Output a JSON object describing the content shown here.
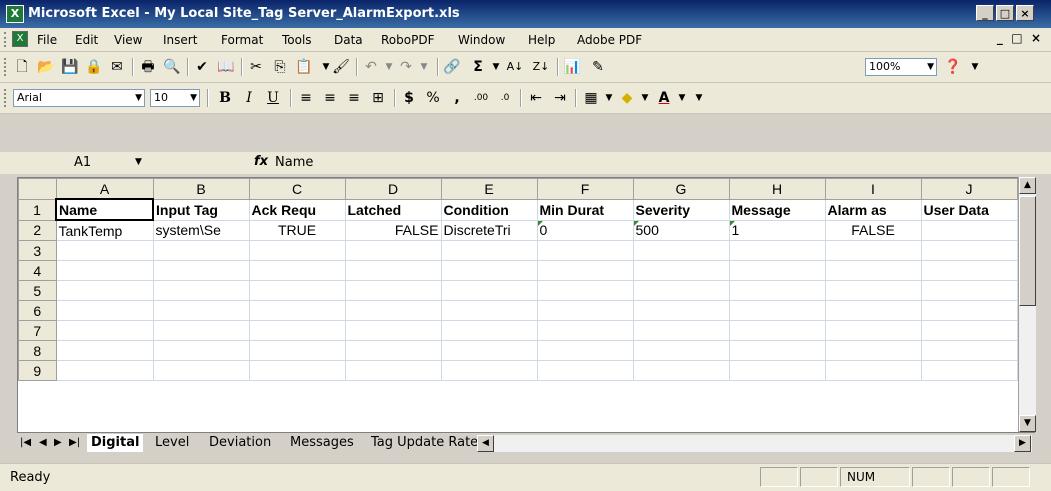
{
  "window": {
    "title": "Microsoft Excel - My Local Site_Tag Server_AlarmExport.xls"
  },
  "menu": [
    "File",
    "Edit",
    "View",
    "Insert",
    "Format",
    "Tools",
    "Data",
    "RoboPDF",
    "Window",
    "Help",
    "Adobe PDF"
  ],
  "toolbar": {
    "zoom": "100%",
    "font": "Arial",
    "size": "10"
  },
  "formula_bar": {
    "cell_ref": "A1",
    "fx": "fx",
    "content": "Name"
  },
  "columns": [
    "A",
    "B",
    "C",
    "D",
    "E",
    "F",
    "G",
    "H",
    "I",
    "J"
  ],
  "rows": [
    "1",
    "2",
    "3",
    "4",
    "5",
    "6",
    "7",
    "8",
    "9"
  ],
  "headers": [
    "Name",
    "Input Tag",
    "Ack Requ",
    "Latched",
    "Condition",
    "Min Durat",
    "Severity",
    "Message",
    "Alarm as",
    "User Data"
  ],
  "row2": [
    "TankTemp",
    "system\\Se",
    "TRUE",
    "FALSE",
    "DiscreteTri",
    "0",
    "500",
    "1",
    "FALSE",
    ""
  ],
  "sheet_tabs": [
    "Digital",
    "Level",
    "Deviation",
    "Messages",
    "Tag Update Rates"
  ],
  "status": {
    "text": "Ready",
    "num": "NUM"
  }
}
